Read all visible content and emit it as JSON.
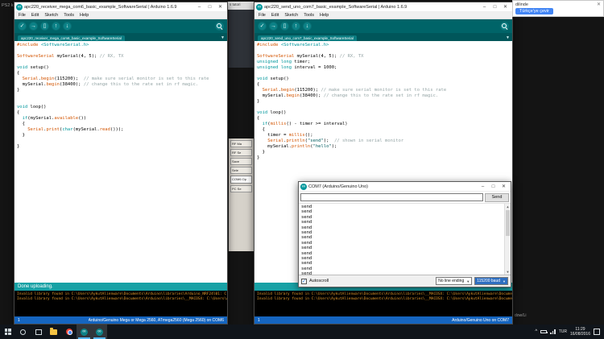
{
  "glyphs": {
    "infinity": "∞",
    "minimize": "–",
    "maximize": "□",
    "close": "✕",
    "verify": "✓",
    "upload": "→",
    "new_sketch": "▯",
    "open": "↑",
    "save": "↓",
    "dropdown": "▼",
    "check": "✓",
    "chevron_up": "^",
    "scroll_up": "▲",
    "scroll_down": "▼"
  },
  "menu": [
    "File",
    "Edit",
    "Sketch",
    "Tools",
    "Help"
  ],
  "windows": {
    "left": {
      "title": "apc220_receiver_mega_com6_basic_example_SoftwareSerial | Arduino 1.6.9",
      "tab": "apc220_receiver_mega_com6_basic_example_SoftwareSerial",
      "status": "Done uploading.",
      "cursor_line": "1",
      "board": "Arduino/Genuino Mega or Mega 2560, ATmega2560 (Mega 2560) on COM6",
      "console_lines": [
        "Invalid library found in C:\\Users\\AykutAlienware\\Documents\\Arduino\\libraries\\Arduino_NRF24l01: C:\\Users\\AykutAlien",
        "Invalid library found in C:\\Users\\AykutAlienware\\Documents\\Arduino\\libraries\\__MACOSX: C:\\Users\\AykutAlienware\\Do"
      ],
      "code": [
        [
          [
            "f",
            "#include "
          ],
          [
            "k",
            "<SoftwareSerial.h>"
          ]
        ],
        [],
        [
          [
            "f",
            "SoftwareSerial"
          ],
          [
            "p",
            " mySerial(4, 5); "
          ],
          [
            "c",
            "// RX, TX"
          ]
        ],
        [],
        [
          [
            "k",
            "void"
          ],
          [
            "p",
            " setup()"
          ]
        ],
        [
          [
            "p",
            "{"
          ]
        ],
        [
          [
            "p",
            "  "
          ],
          [
            "f",
            "Serial"
          ],
          [
            "p",
            "."
          ],
          [
            "f",
            "begin"
          ],
          [
            "p",
            "(115200);  "
          ],
          [
            "c",
            "// make sure serial monitor is set to this rate"
          ]
        ],
        [
          [
            "p",
            "  mySerial."
          ],
          [
            "f",
            "begin"
          ],
          [
            "p",
            "(38400); "
          ],
          [
            "c",
            "// change this to the rate set in rf magic."
          ]
        ],
        [
          [
            "p",
            "}"
          ]
        ],
        [],
        [],
        [
          [
            "k",
            "void"
          ],
          [
            "p",
            " loop()"
          ]
        ],
        [
          [
            "p",
            "{"
          ]
        ],
        [
          [
            "p",
            "  "
          ],
          [
            "k",
            "if"
          ],
          [
            "p",
            "(mySerial."
          ],
          [
            "f",
            "available"
          ],
          [
            "p",
            "())"
          ]
        ],
        [
          [
            "p",
            "  {"
          ]
        ],
        [
          [
            "p",
            "    "
          ],
          [
            "f",
            "Serial"
          ],
          [
            "p",
            "."
          ],
          [
            "f",
            "print"
          ],
          [
            "p",
            "("
          ],
          [
            "k",
            "char"
          ],
          [
            "p",
            "(mySerial."
          ],
          [
            "f",
            "read"
          ],
          [
            "p",
            "()));"
          ]
        ],
        [
          [
            "p",
            "  }"
          ]
        ],
        [],
        [
          [
            "p",
            "}"
          ]
        ]
      ]
    },
    "right": {
      "title": "apc220_send_uno_com7_basic_example_SoftwareSerial | Arduino 1.6.9",
      "tab": "apc220_send_uno_com7_basic_example_SoftwareSerial",
      "status": "",
      "cursor_line": "1",
      "board": "Arduino/Genuino Uno on COM7",
      "console_lines": [
        "Invalid library found in C:\\Users\\AykutAlienware\\Documents\\Arduino\\libraries\\__MACOSX: C:\\Users\\AykutAlienware\\Documents\\Arduino\\libraries",
        "Invalid library found in C:\\Users\\AykutAlienware\\Documents\\Arduino\\libraries\\__MACOSX: C:\\Users\\AykutAlienware\\Documents\\Arduino\\libraries"
      ],
      "code": [
        [
          [
            "f",
            "#include "
          ],
          [
            "k",
            "<SoftwareSerial.h>"
          ]
        ],
        [],
        [
          [
            "f",
            "SoftwareSerial"
          ],
          [
            "p",
            " mySerial(4, 5); "
          ],
          [
            "c",
            "// RX, TX"
          ]
        ],
        [
          [
            "k",
            "unsigned long"
          ],
          [
            "p",
            " timer;"
          ]
        ],
        [
          [
            "k",
            "unsigned long"
          ],
          [
            "p",
            " interval = 1000;"
          ]
        ],
        [],
        [
          [
            "k",
            "void"
          ],
          [
            "p",
            " setup()"
          ]
        ],
        [
          [
            "p",
            "{"
          ]
        ],
        [
          [
            "p",
            "  "
          ],
          [
            "f",
            "Serial"
          ],
          [
            "p",
            "."
          ],
          [
            "f",
            "begin"
          ],
          [
            "p",
            "(115200); "
          ],
          [
            "c",
            "// make sure serial monitor is set to this rate"
          ]
        ],
        [
          [
            "p",
            "  mySerial."
          ],
          [
            "f",
            "begin"
          ],
          [
            "p",
            "(38400); "
          ],
          [
            "c",
            "// change this to the rate set in rf magic."
          ]
        ],
        [
          [
            "p",
            "}"
          ]
        ],
        [],
        [
          [
            "k",
            "void"
          ],
          [
            "p",
            " loop()"
          ]
        ],
        [
          [
            "p",
            "{"
          ]
        ],
        [
          [
            "p",
            "  "
          ],
          [
            "k",
            "if"
          ],
          [
            "p",
            "("
          ],
          [
            "f",
            "millis"
          ],
          [
            "p",
            "() - timer >= interval)"
          ]
        ],
        [
          [
            "p",
            "  {"
          ]
        ],
        [
          [
            "p",
            "    timer = "
          ],
          [
            "f",
            "millis"
          ],
          [
            "p",
            "();"
          ]
        ],
        [
          [
            "p",
            "    "
          ],
          [
            "f",
            "Serial"
          ],
          [
            "p",
            "."
          ],
          [
            "f",
            "println"
          ],
          [
            "p",
            "("
          ],
          [
            "s",
            "\"send\""
          ],
          [
            "p",
            ");  "
          ],
          [
            "c",
            "// shown in serial monitor"
          ]
        ],
        [
          [
            "p",
            "    mySerial."
          ],
          [
            "f",
            "println"
          ],
          [
            "p",
            "("
          ],
          [
            "s",
            "\"hello\""
          ],
          [
            "p",
            ");"
          ]
        ],
        [
          [
            "p",
            "  }"
          ]
        ],
        [
          [
            "p",
            "}"
          ]
        ]
      ]
    }
  },
  "serial_monitor": {
    "title": "COM7 (Arduino/Genuino Uno)",
    "input_value": "",
    "send_button": "Send",
    "lines": [
      "send",
      "send",
      "send",
      "send",
      "send",
      "send",
      "send",
      "send",
      "send",
      "send",
      "send",
      "send",
      "send",
      "send"
    ],
    "autoscroll_label": "Autoscroll",
    "line_ending": "No line ending",
    "baud": "115200 baud"
  },
  "translate_bar": {
    "text": "dilinde",
    "button": "Türkçe'ye çevir"
  },
  "background": {
    "top_left_text": "PS2 k",
    "gap_title": "s tutori",
    "gap_buttons": [
      "RF Ma",
      "RF Se",
      "Save",
      "Sele"
    ],
    "com_label": "COM6 Op",
    "pc_label": "PC Se",
    "right_edge_text": "dow/Li"
  },
  "taskbar": {
    "icons": [
      "start",
      "search",
      "task-view",
      "file-explorer",
      "chrome",
      "arduino-receiver",
      "arduino-sender"
    ],
    "tray": {
      "lang": "TUR",
      "time": "11:29",
      "date": "16/08/2016"
    }
  },
  "colors": {
    "teal": "#006468",
    "teal_light": "#17a1a5",
    "accent_blue": "#1565c0",
    "console_orange": "#e39a2d"
  }
}
